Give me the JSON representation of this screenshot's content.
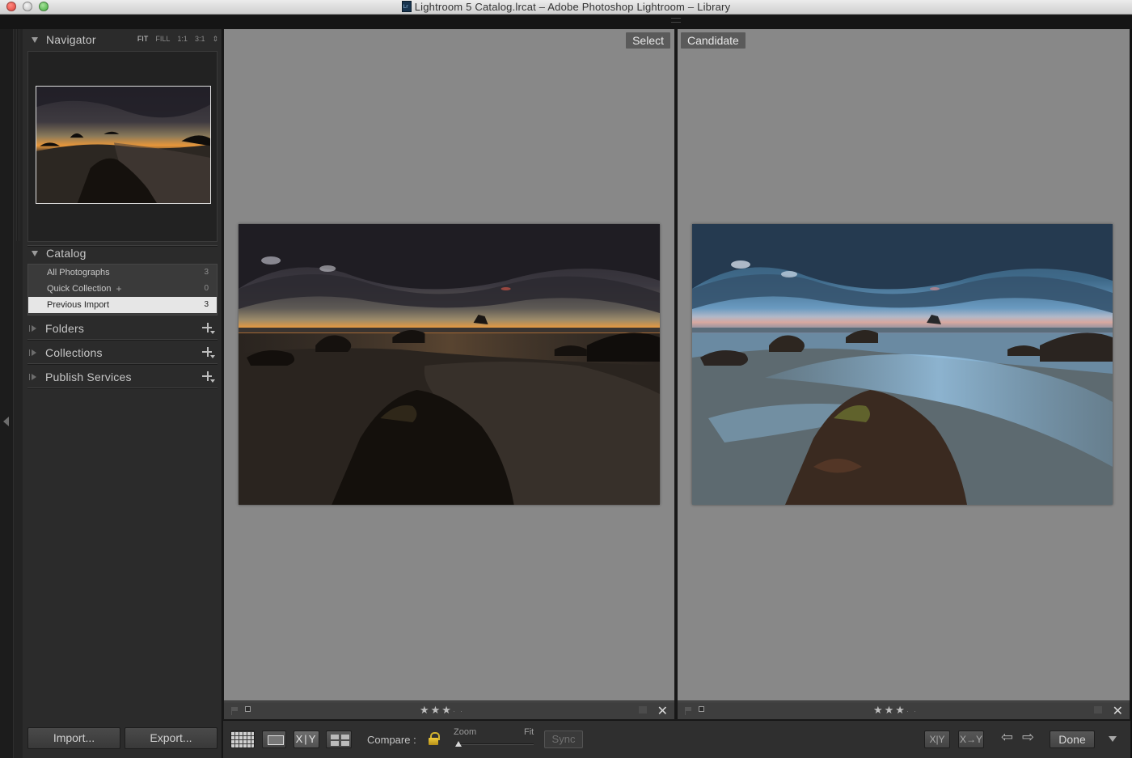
{
  "window": {
    "title": "Lightroom 5 Catalog.lrcat – Adobe Photoshop Lightroom – Library"
  },
  "navigator": {
    "title": "Navigator",
    "modes": [
      "FIT",
      "FILL",
      "1:1",
      "3:1"
    ],
    "active_mode": "FIT"
  },
  "catalog": {
    "title": "Catalog",
    "items": [
      {
        "label": "All Photographs",
        "count": "3"
      },
      {
        "label": "Quick Collection",
        "suffix": "+",
        "count": "0"
      },
      {
        "label": "Previous Import",
        "count": "3",
        "selected": true
      }
    ]
  },
  "panels": {
    "folders": "Folders",
    "collections": "Collections",
    "publish": "Publish Services"
  },
  "left_buttons": {
    "import": "Import...",
    "export": "Export..."
  },
  "compare": {
    "select_label": "Select",
    "candidate_label": "Candidate",
    "select_rating": 3,
    "candidate_rating": 3,
    "max_rating": 5
  },
  "toolbar": {
    "grid_view": "grid-icon",
    "loupe_view": "loupe-icon",
    "compare_view": "X|Y",
    "survey_view": "survey-icon",
    "compare_label": "Compare :",
    "zoom_label": "Zoom",
    "fit_label": "Fit",
    "zoom_level": 0,
    "sync_label": "Sync",
    "swap_label": "X|Y",
    "make_select_label": "X→Y",
    "done_label": "Done"
  },
  "colors": {
    "pane_background": "#888888",
    "selected_row": "#e6e6e6",
    "lock_icon": "#e6c232"
  }
}
